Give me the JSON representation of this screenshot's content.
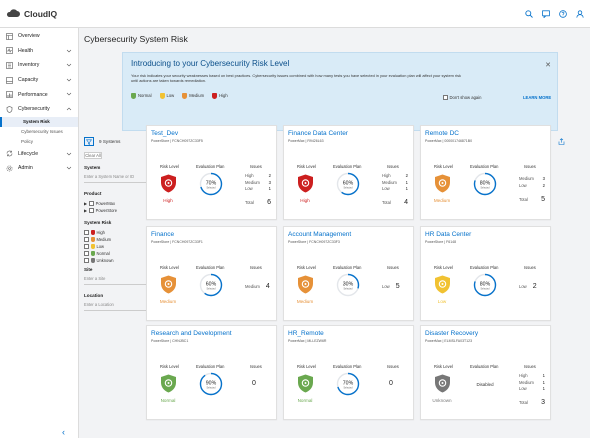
{
  "app": {
    "brand": "CloudIQ"
  },
  "sidebar": {
    "items": [
      {
        "label": "Overview",
        "icon": "overview-icon",
        "expandable": false
      },
      {
        "label": "Health",
        "icon": "health-icon",
        "expandable": true
      },
      {
        "label": "Inventory",
        "icon": "inventory-icon",
        "expandable": true
      },
      {
        "label": "Capacity",
        "icon": "capacity-icon",
        "expandable": true
      },
      {
        "label": "Performance",
        "icon": "performance-icon",
        "expandable": true
      },
      {
        "label": "Cybersecurity",
        "icon": "cybersecurity-icon",
        "expandable": true,
        "expanded": true
      },
      {
        "label": "Lifecycle",
        "icon": "lifecycle-icon",
        "expandable": true
      },
      {
        "label": "Admin",
        "icon": "admin-icon",
        "expandable": true
      }
    ],
    "cyber_sub": [
      {
        "label": "System Risk",
        "active": true
      },
      {
        "label": "Cybersecurity Issues",
        "active": false
      },
      {
        "label": "Policy",
        "active": false
      }
    ]
  },
  "page": {
    "title": "Cybersecurity System Risk"
  },
  "banner": {
    "title": "Introducing to your Cybersecurity Risk Level",
    "text": "Your risk indicates your security weaknesses based on best practices. Cybersecurity issues combined with how many tests you have selected in your evaluation plan will affect your system risk until actions are taken towards remediation.",
    "legend": [
      {
        "label": "Normal",
        "color": "#6aa84f"
      },
      {
        "label": "Low",
        "color": "#f1c232"
      },
      {
        "label": "Medium",
        "color": "#e69138"
      },
      {
        "label": "High",
        "color": "#cc1f1f"
      }
    ],
    "dont_show": "Don't show again",
    "learn_more": "LEARN MORE"
  },
  "toolbar": {
    "systems_count": "9 Systems"
  },
  "filters": {
    "clear_all": "Clear All",
    "system_head": "System",
    "system_placeholder": "Enter a System Name or ID",
    "product_head": "Product",
    "products": [
      "PowerMax",
      "PowerStore"
    ],
    "risk_head": "System Risk",
    "risks": [
      {
        "label": "High",
        "color": "#cc1f1f"
      },
      {
        "label": "Medium",
        "color": "#e69138"
      },
      {
        "label": "Low",
        "color": "#f1c232"
      },
      {
        "label": "Normal",
        "color": "#6aa84f"
      },
      {
        "label": "Unknown",
        "color": "#777777"
      }
    ],
    "site_head": "Site",
    "site_placeholder": "Enter a Site",
    "location_head": "Location",
    "location_placeholder": "Enter a Location"
  },
  "card_labels": {
    "risk_level": "Risk Level",
    "eval_plan": "Evaluation Plan",
    "issues": "Issues",
    "total": "Total",
    "selected": "Selected"
  },
  "cards": [
    {
      "name": "Test_Dev",
      "subtitle": "PowerStore | FCNCH097ZC33F5",
      "risk": "High",
      "color": "#cc1f1f",
      "eval": "70%",
      "eval_pct": 70,
      "issues": [
        {
          "label": "High",
          "count": "2"
        },
        {
          "label": "Medium",
          "count": "3"
        },
        {
          "label": "Low",
          "count": "1"
        }
      ],
      "total": "6"
    },
    {
      "name": "Finance Data Center",
      "subtitle": "PowerMax | R9426L63",
      "risk": "High",
      "color": "#cc1f1f",
      "eval": "60%",
      "eval_pct": 60,
      "issues": [
        {
          "label": "High",
          "count": "2"
        },
        {
          "label": "Medium",
          "count": "1"
        },
        {
          "label": "Low",
          "count": "1"
        }
      ],
      "total": "4"
    },
    {
      "name": "Remote DC",
      "subtitle": "PowerMax | 000001746871B0",
      "risk": "Medium",
      "color": "#e69138",
      "eval": "80%",
      "eval_pct": 80,
      "issues": [
        {
          "label": "Medium",
          "count": "3"
        },
        {
          "label": "Low",
          "count": "2"
        }
      ],
      "total": "5"
    },
    {
      "name": "Finance",
      "subtitle": "PowerStore | FCNCH097ZC33F1",
      "risk": "Medium",
      "color": "#e69138",
      "eval": "60%",
      "eval_pct": 60,
      "single": {
        "label": "Medium",
        "count": "4"
      }
    },
    {
      "name": "Account Management",
      "subtitle": "PowerStore | FCNCH097ZC33F3",
      "risk": "Medium",
      "color": "#e69138",
      "eval": "30%",
      "eval_pct": 30,
      "single": {
        "label": "Low",
        "count": "5"
      }
    },
    {
      "name": "HR Data Center",
      "subtitle": "PowerStore | F6148",
      "risk": "Low",
      "color": "#f1c232",
      "eval": "80%",
      "eval_pct": 80,
      "single": {
        "label": "Low",
        "count": "2"
      }
    },
    {
      "name": "Research and Development",
      "subtitle": "PowerStore | CHNJBC1",
      "risk": "Normal",
      "color": "#6aa84f",
      "eval": "90%",
      "eval_pct": 90,
      "zero": "0"
    },
    {
      "name": "HR_Remote",
      "subtitle": "PowerMax | MLLEZW6R",
      "risk": "Normal",
      "color": "#6aa84f",
      "eval": "70%",
      "eval_pct": 70,
      "zero": "0"
    },
    {
      "name": "Disaster Recovery",
      "subtitle": "PowerMax | ELMSLFA03T123",
      "risk": "Unknown",
      "color": "#777777",
      "eval_text": "Disabled",
      "issues": [
        {
          "label": "High",
          "count": "1"
        },
        {
          "label": "Medium",
          "count": "1"
        },
        {
          "label": "Low",
          "count": "1"
        }
      ],
      "total": "3"
    }
  ]
}
